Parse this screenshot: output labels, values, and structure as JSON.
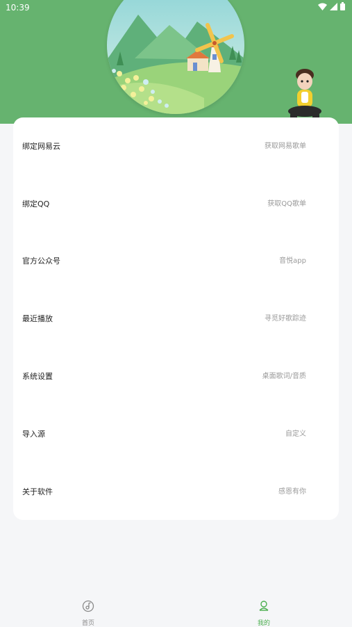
{
  "status": {
    "time": "10:39"
  },
  "menu": [
    {
      "label": "绑定网易云",
      "hint": "获取网易歌单"
    },
    {
      "label": "绑定QQ",
      "hint": "获取QQ歌单"
    },
    {
      "label": "官方公众号",
      "hint": "音悦app"
    },
    {
      "label": "最近播放",
      "hint": "寻觅好歌踪迹"
    },
    {
      "label": "系统设置",
      "hint": "桌面歌词/音质"
    },
    {
      "label": "导入源",
      "hint": "自定义"
    },
    {
      "label": "关于软件",
      "hint": "感恩有你"
    }
  ],
  "tabs": [
    {
      "label": "首页",
      "icon": "music-disc-icon",
      "active": false
    },
    {
      "label": "我的",
      "icon": "user-icon",
      "active": true
    }
  ],
  "colors": {
    "accent": "#66b36f",
    "active_tab": "#4caf50",
    "inactive_tab": "#8a8a8a"
  }
}
